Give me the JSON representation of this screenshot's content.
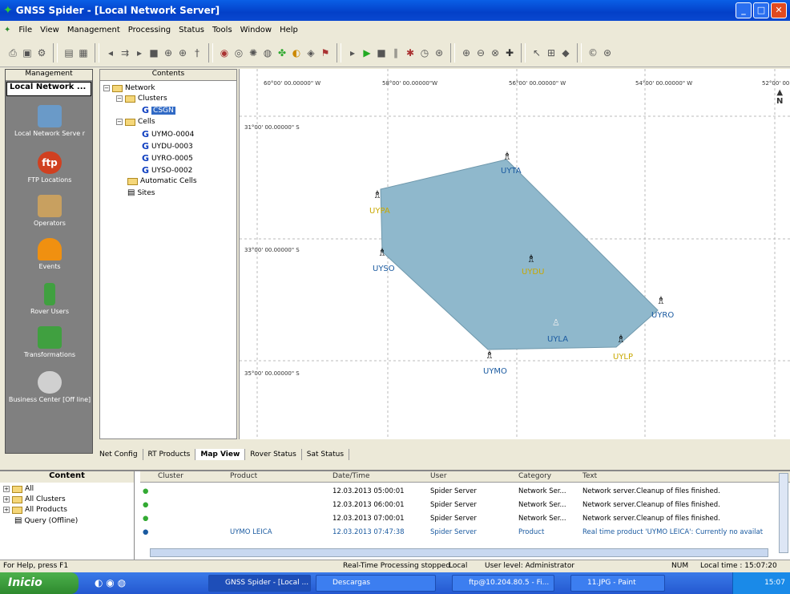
{
  "window": {
    "title": "GNSS Spider - [Local Network Server]"
  },
  "menu": [
    "File",
    "View",
    "Management",
    "Processing",
    "Status",
    "Tools",
    "Window",
    "Help"
  ],
  "left_panel": {
    "header": "Management",
    "selected": "Local Network ...",
    "items": [
      "Local Network Serve r",
      "FTP Locations",
      "Operators",
      "Events",
      "Rover Users",
      "Transformations",
      "Business Center [Off line]"
    ]
  },
  "tree": {
    "header": "Contents",
    "network": "Network",
    "clusters": "Clusters",
    "cluster_item": "CSGN",
    "cells": "Cells",
    "cell_items": [
      "UYMO-0004",
      "UYDU-0003",
      "UYRO-0005",
      "UYSO-0002"
    ],
    "automatic": "Automatic Cells",
    "sites": "Sites"
  },
  "map": {
    "lon_labels": [
      "60°00' 00.00000\" W",
      "58°00' 00.00000\"W",
      "56°00' 00.00000\" W",
      "54°00' 00.00000\" W",
      "52°00' 00."
    ],
    "lat_labels": [
      "31°00' 00.00000\" S",
      "33°00' 00.00000\" S",
      "35°00' 00.00000\" S"
    ],
    "north": "N",
    "stations": [
      {
        "name": "UYTA",
        "color": "#1a5aa0"
      },
      {
        "name": "UYPA",
        "color": "#c8a800"
      },
      {
        "name": "UYSO",
        "color": "#1a5aa0"
      },
      {
        "name": "UYDU",
        "color": "#c8a800"
      },
      {
        "name": "UYRO",
        "color": "#1a5aa0"
      },
      {
        "name": "UYLA",
        "color": "#1a5aa0"
      },
      {
        "name": "UYLP",
        "color": "#c8a800"
      },
      {
        "name": "UYMO",
        "color": "#1a5aa0"
      }
    ],
    "polygon_color": "#8fb8cc"
  },
  "tabs": [
    "Net Config",
    "RT Products",
    "Map View",
    "Rover Status",
    "Sat Status"
  ],
  "log": {
    "left_header": "Content",
    "left_items": [
      "All",
      "All Clusters",
      "All Products",
      "Query (Offline)"
    ],
    "columns": [
      "Cluster",
      "Product",
      "Date/Time",
      "User",
      "Category",
      "Text"
    ],
    "rows": [
      {
        "product": "",
        "datetime": "12.03.2013 05:00:01",
        "user": "Spider Server",
        "category": "Network Ser...",
        "text": "Network server.Cleanup of files finished."
      },
      {
        "product": "",
        "datetime": "12.03.2013 06:00:01",
        "user": "Spider Server",
        "category": "Network Ser...",
        "text": "Network server.Cleanup of files finished."
      },
      {
        "product": "",
        "datetime": "12.03.2013 07:00:01",
        "user": "Spider Server",
        "category": "Network Ser...",
        "text": "Network server.Cleanup of files finished."
      },
      {
        "product": "UYMO LEICA",
        "datetime": "12.03.2013 07:47:38",
        "user": "Spider Server",
        "category": "Product",
        "text": "Real time product 'UYMO LEICA': Currently no availat"
      }
    ]
  },
  "status": {
    "help": "For Help, press F1",
    "processing": "Real-Time Processing stopped",
    "mode": "Local",
    "user_level": "User level: Administrator",
    "num": "NUM",
    "time": "Local time : 15:07:20"
  },
  "taskbar": {
    "start": "Inicio",
    "tasks": [
      "GNSS Spider - [Local ...",
      "Descargas",
      "ftp@10.204.80.5 - Fi...",
      "11.JPG - Paint"
    ],
    "clock": "15:07"
  }
}
